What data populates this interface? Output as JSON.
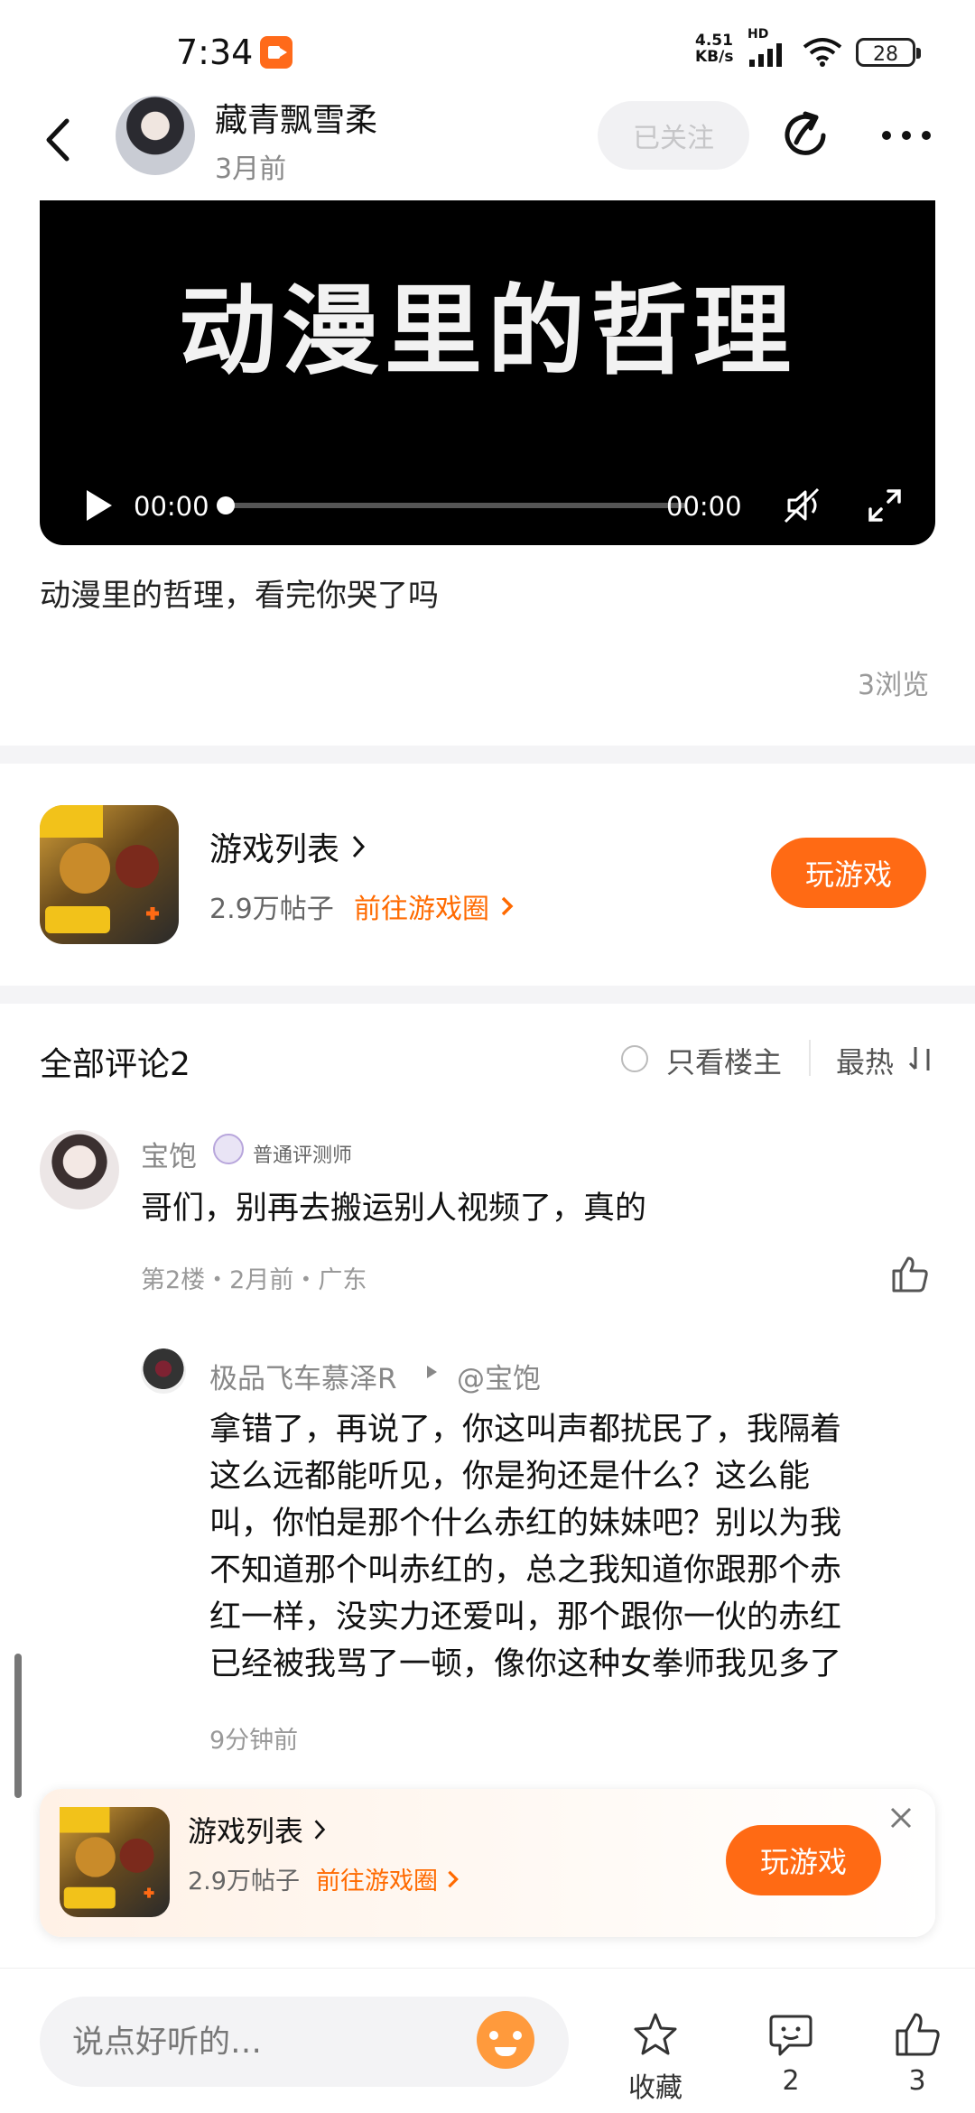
{
  "status_bar": {
    "time": "7:34",
    "net_speed_top": "4.51",
    "net_speed_unit": "KB/s",
    "signal_label": "HD",
    "battery": "28"
  },
  "header": {
    "author_name": "藏青飘雪柔",
    "author_time": "3月前",
    "follow_label": "已关注"
  },
  "video": {
    "title_overlay": "动漫里的哲理",
    "current_time": "00:00",
    "total_time": "00:00",
    "progress": 0
  },
  "post": {
    "text": "动漫里的哲理，看完你哭了吗",
    "views": "3浏览"
  },
  "game_card": {
    "name": "游戏列表",
    "posts": "2.9万帖子",
    "link": "前往游戏圈",
    "play_label": "玩游戏"
  },
  "comments": {
    "title": "全部评论2",
    "only_owner": "只看楼主",
    "sort": "最热"
  },
  "comment1": {
    "name": "宝饱",
    "badge": "普通评测师",
    "text": "哥们，别再去搬运别人视频了，真的",
    "meta": "第2楼・2月前・广东"
  },
  "reply1": {
    "name": "极品飞车慕泽R",
    "at": "@宝饱",
    "lines": [
      "拿错了，再说了，你这叫声都扰民了，我隔着",
      "这么远都能听见，你是狗还是什么？这么能",
      "叫，你怕是那个什么赤红的妹妹吧？别以为我",
      "不知道那个叫赤红的，总之我知道你跟那个赤",
      "红一样，没实力还爱叫，那个跟你一伙的赤红",
      "已经被我骂了一顿，像你这种女拳师我见多了"
    ],
    "time": "9分钟前"
  },
  "float_card": {
    "name": "游戏列表",
    "posts": "2.9万帖子",
    "link": "前往游戏圈",
    "play_label": "玩游戏"
  },
  "bottom_bar": {
    "input_placeholder": "说点好听的…",
    "favorite_label": "收藏",
    "comment_count": "2",
    "like_count": "3"
  },
  "colors": {
    "accent": "#ff6a14",
    "link": "#ff6a00"
  }
}
